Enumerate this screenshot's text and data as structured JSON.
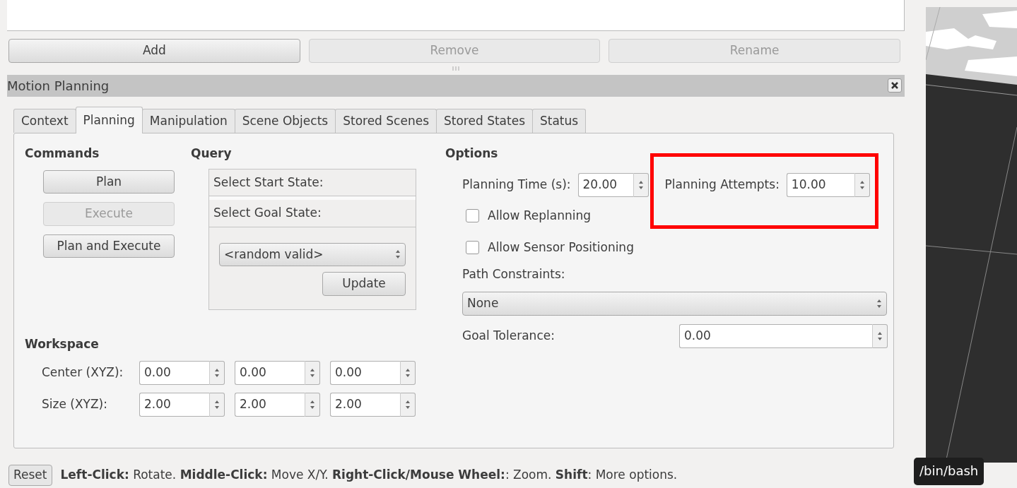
{
  "top_buttons": [
    {
      "label": "Add",
      "disabled": false
    },
    {
      "label": "Remove",
      "disabled": true
    },
    {
      "label": "Rename",
      "disabled": true
    }
  ],
  "panel": {
    "title": "Motion Planning"
  },
  "tabs": [
    {
      "label": "Context",
      "selected": false
    },
    {
      "label": "Planning",
      "selected": true
    },
    {
      "label": "Manipulation",
      "selected": false
    },
    {
      "label": "Scene Objects",
      "selected": false
    },
    {
      "label": "Stored Scenes",
      "selected": false
    },
    {
      "label": "Stored States",
      "selected": false
    },
    {
      "label": "Status",
      "selected": false
    }
  ],
  "commands": {
    "heading": "Commands",
    "buttons": [
      {
        "label": "Plan",
        "disabled": false
      },
      {
        "label": "Execute",
        "disabled": true
      },
      {
        "label": "Plan and Execute",
        "disabled": false
      }
    ]
  },
  "query": {
    "heading": "Query",
    "start_label": "Select Start State:",
    "goal_label": "Select Goal State:",
    "goal_combo": "<random valid>",
    "update_button": "Update"
  },
  "options": {
    "heading": "Options",
    "planning_time": {
      "label": "Planning Time (s):",
      "value": "20.00"
    },
    "planning_attempts": {
      "label": "Planning Attempts:",
      "value": "10.00",
      "highlighted": true
    },
    "checkboxes": [
      {
        "label": "Allow Replanning",
        "checked": false
      },
      {
        "label": "Allow Sensor Positioning",
        "checked": false
      }
    ],
    "path_constraints": {
      "label": "Path Constraints:",
      "value": "None"
    },
    "goal_tolerance": {
      "label": "Goal Tolerance:",
      "value": "0.00"
    }
  },
  "workspace": {
    "heading": "Workspace",
    "rows": [
      {
        "label": "Center (XYZ):",
        "values": [
          "0.00",
          "0.00",
          "0.00"
        ]
      },
      {
        "label": "Size (XYZ):",
        "values": [
          "2.00",
          "2.00",
          "2.00"
        ]
      }
    ]
  },
  "status_bar": {
    "reset_button": "Reset",
    "hint": "**Left-Click:** Rotate. **Middle-Click:** Move X/Y. **Right-Click/Mouse Wheel:**: Zoom. **Shift**: More options."
  },
  "tooltip": "/bin/bash"
}
